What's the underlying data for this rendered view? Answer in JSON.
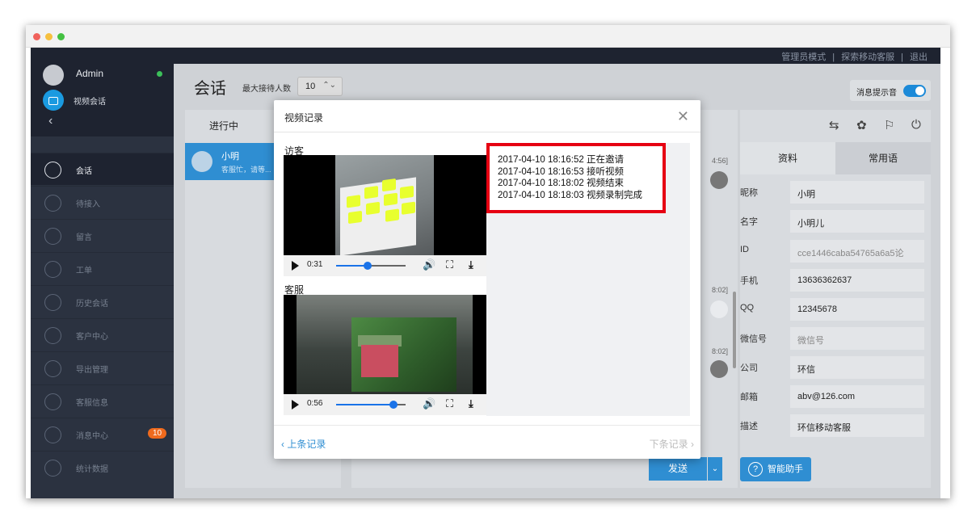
{
  "window": {
    "dots": [
      "#f0625c",
      "#f6c03f",
      "#44c142"
    ]
  },
  "top_links": [
    "管理员模式",
    "|",
    "探索移动客服",
    "|",
    "退出"
  ],
  "sidebar": {
    "user": "Admin",
    "channel": "视频会话",
    "nav": [
      {
        "label": "会话",
        "icon": "chat-icon",
        "active": true
      },
      {
        "label": "待接入",
        "icon": "hourglass-icon"
      },
      {
        "label": "留言",
        "icon": "message-edit-icon"
      },
      {
        "label": "工单",
        "icon": "ticket-icon"
      },
      {
        "label": "历史会话",
        "icon": "history-icon"
      },
      {
        "label": "客户中心",
        "icon": "customer-icon"
      },
      {
        "label": "导出管理",
        "icon": "export-icon"
      },
      {
        "label": "客服信息",
        "icon": "settings-icon"
      },
      {
        "label": "消息中心",
        "icon": "bell-icon",
        "badge": "10"
      },
      {
        "label": "统计数据",
        "icon": "chart-icon"
      }
    ]
  },
  "header": {
    "title": "会话",
    "max_label": "最大接待人数",
    "max_value": "10",
    "sound_label": "消息提示音"
  },
  "conversations": {
    "tab": "进行中",
    "items": [
      {
        "name": "小明",
        "snippet": "客服忙，请等..."
      }
    ]
  },
  "chat": {
    "timestamps": [
      "4:56]",
      "8:02]",
      "8:02]"
    ],
    "send_label": "发送",
    "send_more": "⌄"
  },
  "profile": {
    "tabs": [
      "资料",
      "常用语"
    ],
    "fields": [
      {
        "label": "昵称",
        "value": "小明"
      },
      {
        "label": "名字",
        "value": "小明儿"
      },
      {
        "label": "ID",
        "value": "cce1446caba54765a6a5论",
        "placeholder": true
      },
      {
        "label": "手机",
        "value": "13636362637"
      },
      {
        "label": "QQ",
        "value": "12345678"
      },
      {
        "label": "微信号",
        "value": "微信号",
        "placeholder": true
      },
      {
        "label": "公司",
        "value": "环信"
      },
      {
        "label": "邮箱",
        "value": "abv@126.com"
      },
      {
        "label": "描述",
        "value": "环信移动客服"
      }
    ],
    "assistant_label": "智能助手"
  },
  "modal": {
    "title": "视频记录",
    "visitor_label": "访客",
    "agent_label": "客服",
    "visitor_video": {
      "time": "0:31",
      "progress": 0.45
    },
    "agent_video": {
      "time": "0:56",
      "progress": 0.82
    },
    "log": [
      "2017-04-10 18:16:52 正在邀请",
      "2017-04-10 18:16:53 接听视频",
      "2017-04-10 18:18:02 视频结束",
      "2017-04-10 18:18:03 视频录制完成"
    ],
    "prev_label": "上条记录",
    "next_label": "下条记录",
    "highlight_color": "#e60012"
  },
  "colors": {
    "accent": "#2f8ed2",
    "badge": "#ef6a1d",
    "online": "#3cc05a"
  }
}
